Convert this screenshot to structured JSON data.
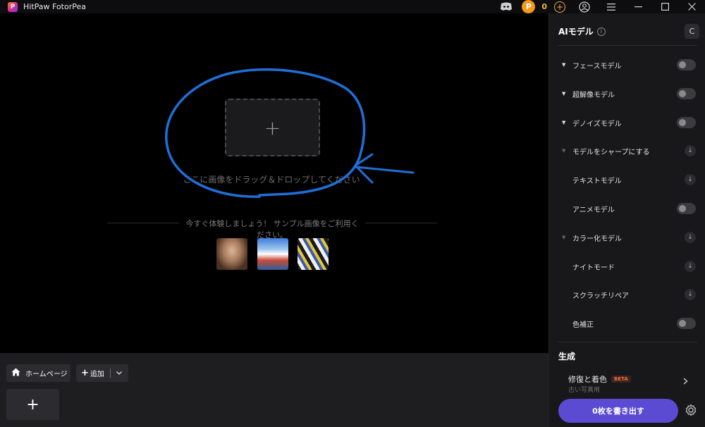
{
  "app": {
    "logo_letter": "P",
    "title": "HitPaw FotorPea"
  },
  "titlebar": {
    "credits": "0",
    "coin_letter": "P",
    "add_credit": "+",
    "icons": [
      "discord-icon",
      "coin-icon",
      "add-credits-icon",
      "user-icon",
      "menu-icon",
      "minimize-icon",
      "maximize-icon",
      "close-icon"
    ]
  },
  "canvas": {
    "drop_plus": "+",
    "drop_text": "ここに画像をドラッグ＆ドロップしてください",
    "sample_text": "今すぐ体験しましょう！ サンプル画像をご利用ください。"
  },
  "bottom": {
    "home_label": "ホームページ",
    "add_label": "追加",
    "new_plus": "+"
  },
  "panel": {
    "title": "AIモデル",
    "info": "i",
    "reset": "C",
    "models": [
      {
        "label": "フェースモデル",
        "control": "toggle"
      },
      {
        "label": "超解像モデル",
        "control": "toggle"
      },
      {
        "label": "デノイズモデル",
        "control": "toggle"
      },
      {
        "label": "モデルをシャープにする",
        "control": "download"
      },
      {
        "label": "テキストモデル",
        "control": "download"
      },
      {
        "label": "アニメモデル",
        "control": "toggle"
      },
      {
        "label": "カラー化モデル",
        "control": "download"
      },
      {
        "label": "ナイトモード",
        "control": "download"
      },
      {
        "label": "スクラッチリペア",
        "control": "download"
      },
      {
        "label": "色補正",
        "control": "toggle"
      }
    ],
    "generate_title": "生成",
    "generate_item": "修復と着色",
    "beta": "BETA",
    "generate_sub": "古い写真用",
    "export_label": "0枚を書き出す"
  },
  "colors": {
    "accent": "#5b4bd3",
    "credit": "#f4b23a",
    "annotation": "#1f6fd8"
  }
}
